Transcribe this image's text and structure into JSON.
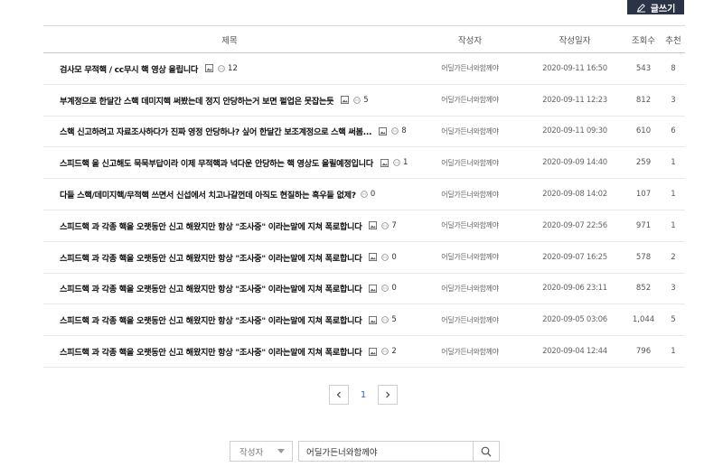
{
  "toolbar": {
    "write_label": "글쓰기"
  },
  "table": {
    "headers": {
      "title": "제목",
      "author": "작성자",
      "date": "작성일자",
      "views": "조회수",
      "recommend": "추천"
    },
    "rows": [
      {
        "title": "검사모 무적핵 / cc무시 핵 영상 올립니다",
        "has_image": true,
        "comments": "12",
        "author": "어딜가든너와함께야",
        "date": "2020-09-11 16:50",
        "views": "543",
        "recommend": "8"
      },
      {
        "title": "부계정으로 한달간 스핵 데미지핵 써봤는데 정지 안당하는거 보면 펄업은 못잡는듯",
        "has_image": true,
        "comments": "5",
        "author": "어딜가든너와함께야",
        "date": "2020-09-11 12:23",
        "views": "812",
        "recommend": "3"
      },
      {
        "title": "스핵 신고하려고 자료조사하다가 진짜 영정 안당하나? 싶어 한달간 보조계정으로 스핵 써봄...",
        "has_image": true,
        "comments": "8",
        "author": "어딜가든너와함께야",
        "date": "2020-09-11 09:30",
        "views": "610",
        "recommend": "6"
      },
      {
        "title": "스피드핵 을 신고해도 묵묵부답이라 이제 무적핵과 넉다운 안당하는 핵 영상도 올릴예정입니다",
        "has_image": true,
        "comments": "1",
        "author": "어딜가든너와함께야",
        "date": "2020-09-09 14:40",
        "views": "259",
        "recommend": "1"
      },
      {
        "title": "다들 스핵/데미지핵/무적핵 쓰면서 신섭에서 치고나갈껀데 아직도 현질하는 흑우들 없제?",
        "has_image": false,
        "comments": "0",
        "author": "어딜가든너와함께야",
        "date": "2020-09-08 14:02",
        "views": "107",
        "recommend": "1"
      },
      {
        "title": "스피드핵 과 각종 핵을 오랫동안 신고 해왔지만 항상 \"조사중\" 이라는말에 지쳐 폭로합니다",
        "has_image": true,
        "comments": "7",
        "author": "어딜가든너와함께야",
        "date": "2020-09-07 22:56",
        "views": "971",
        "recommend": "1"
      },
      {
        "title": "스피드핵 과 각종 핵을 오랫동안 신고 해왔지만 항상 \"조사중\" 이라는말에 지쳐 폭로합니다",
        "has_image": true,
        "comments": "0",
        "author": "어딜가든너와함께야",
        "date": "2020-09-07 16:25",
        "views": "578",
        "recommend": "2"
      },
      {
        "title": "스피드핵 과 각종 핵을 오랫동안 신고 해왔지만 항상 \"조사중\" 이라는말에 지쳐 폭로합니다",
        "has_image": true,
        "comments": "0",
        "author": "어딜가든너와함께야",
        "date": "2020-09-06 23:11",
        "views": "852",
        "recommend": "3"
      },
      {
        "title": "스피드핵 과 각종 핵을 오랫동안 신고 해왔지만 항상 \"조사중\" 이라는말에 지쳐 폭로합니다",
        "has_image": true,
        "comments": "5",
        "author": "어딜가든너와함께야",
        "date": "2020-09-05 03:06",
        "views": "1,044",
        "recommend": "5"
      },
      {
        "title": "스피드핵 과 각종 핵을 오랫동안 신고 해왔지만 항상 \"조사중\" 이라는말에 지쳐 폭로합니다",
        "has_image": true,
        "comments": "2",
        "author": "어딜가든너와함께야",
        "date": "2020-09-04 12:44",
        "views": "796",
        "recommend": "1"
      }
    ]
  },
  "pagination": {
    "current_page": "1"
  },
  "search": {
    "filter_selected": "작성자",
    "query": "어딜가든너와함께야"
  },
  "icons": {
    "write": "pencil-icon",
    "image": "image-icon",
    "comment": "comment-icon",
    "prev": "chevron-left-icon",
    "next": "chevron-right-icon",
    "search": "search-icon",
    "dropdown": "caret-down-icon"
  },
  "colors": {
    "write_button_bg": "#2a3446",
    "active_page": "#2b5fd9"
  }
}
